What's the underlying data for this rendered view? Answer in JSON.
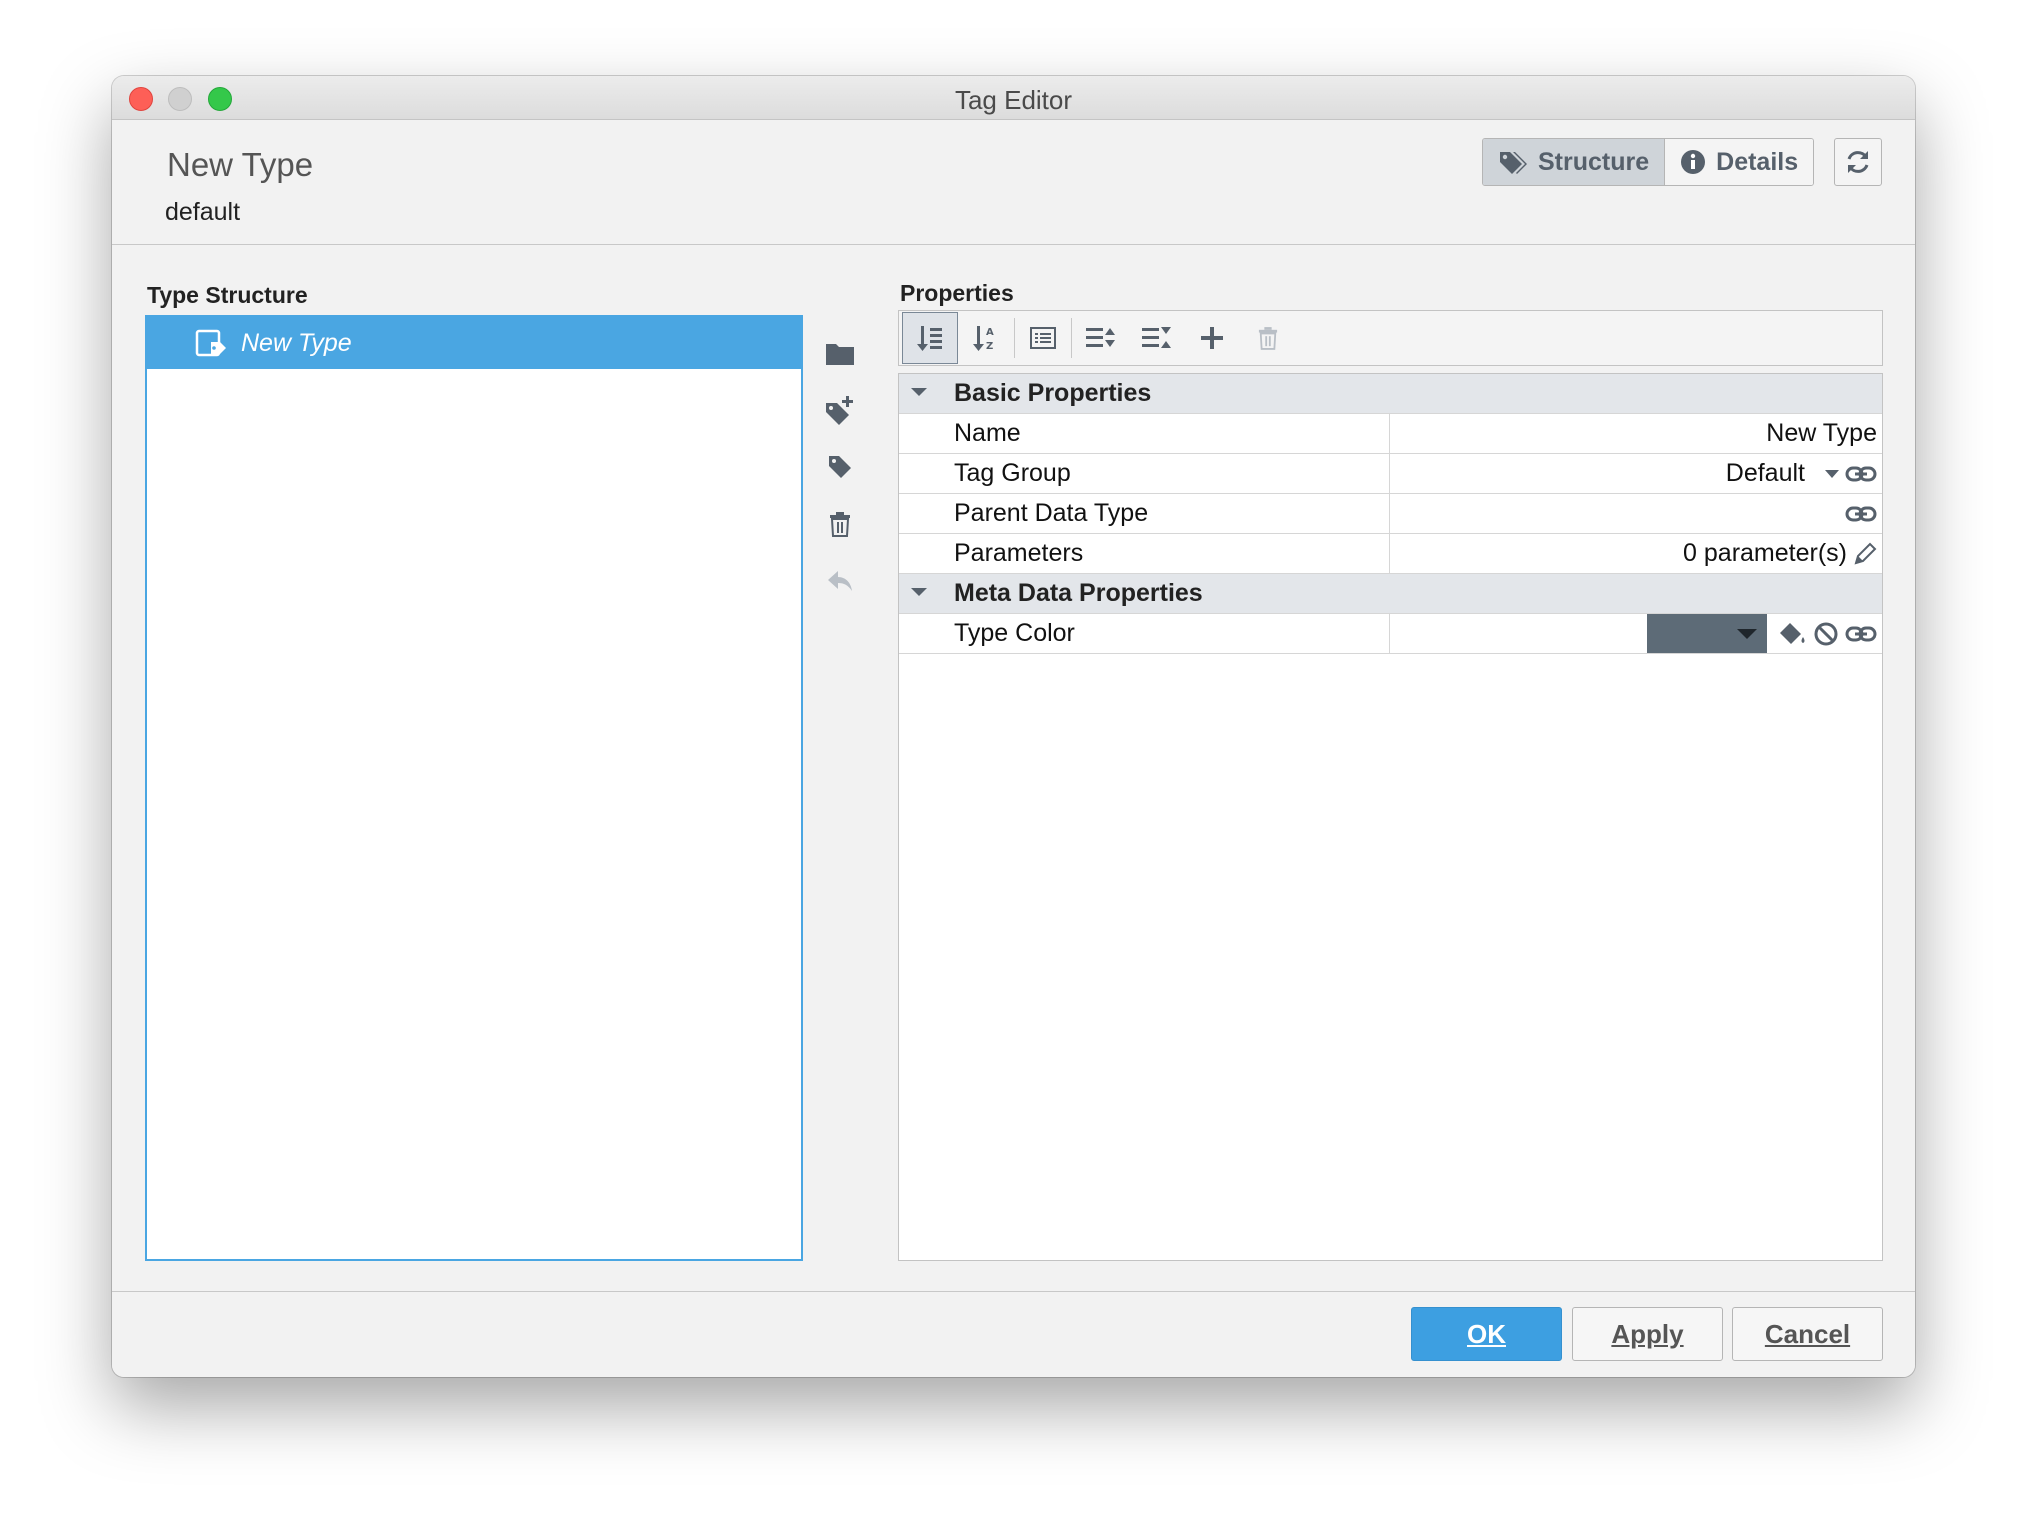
{
  "window": {
    "title": "Tag Editor"
  },
  "header": {
    "type_name": "New Type",
    "subtitle": "default",
    "tabs": [
      {
        "label": "Structure",
        "icon": "tags-icon",
        "active": true
      },
      {
        "label": "Details",
        "icon": "info-icon",
        "active": false
      }
    ],
    "refresh_icon": "refresh-icon"
  },
  "type_structure": {
    "label": "Type Structure",
    "items": [
      {
        "label": "New Type",
        "icon": "udt-definition-icon",
        "selected": true
      }
    ]
  },
  "side_tools": [
    "new-folder-icon",
    "add-tag-icon",
    "tag-icon",
    "delete-icon",
    "undo-icon"
  ],
  "properties": {
    "label": "Properties",
    "toolbar": [
      "sort-category-icon",
      "sort-alpha-icon",
      "description-icon",
      "expand-all-icon",
      "collapse-all-icon",
      "add-icon",
      "delete-icon"
    ],
    "groups": [
      {
        "name": "Basic Properties",
        "rows": [
          {
            "name": "Name",
            "value": "New Type"
          },
          {
            "name": "Tag Group",
            "value": "Default"
          },
          {
            "name": "Parent Data Type",
            "value": ""
          },
          {
            "name": "Parameters",
            "value": "0 parameter(s)"
          }
        ]
      },
      {
        "name": "Meta Data Properties",
        "rows": [
          {
            "name": "Type Color",
            "value": "",
            "swatch_color": "#5d6b77"
          }
        ]
      }
    ]
  },
  "footer": {
    "ok": "OK",
    "apply": "Apply",
    "cancel": "Cancel"
  },
  "colors": {
    "accent": "#4aa6e2",
    "primary_button": "#3d9fe1",
    "icon_gray": "#56606b"
  }
}
